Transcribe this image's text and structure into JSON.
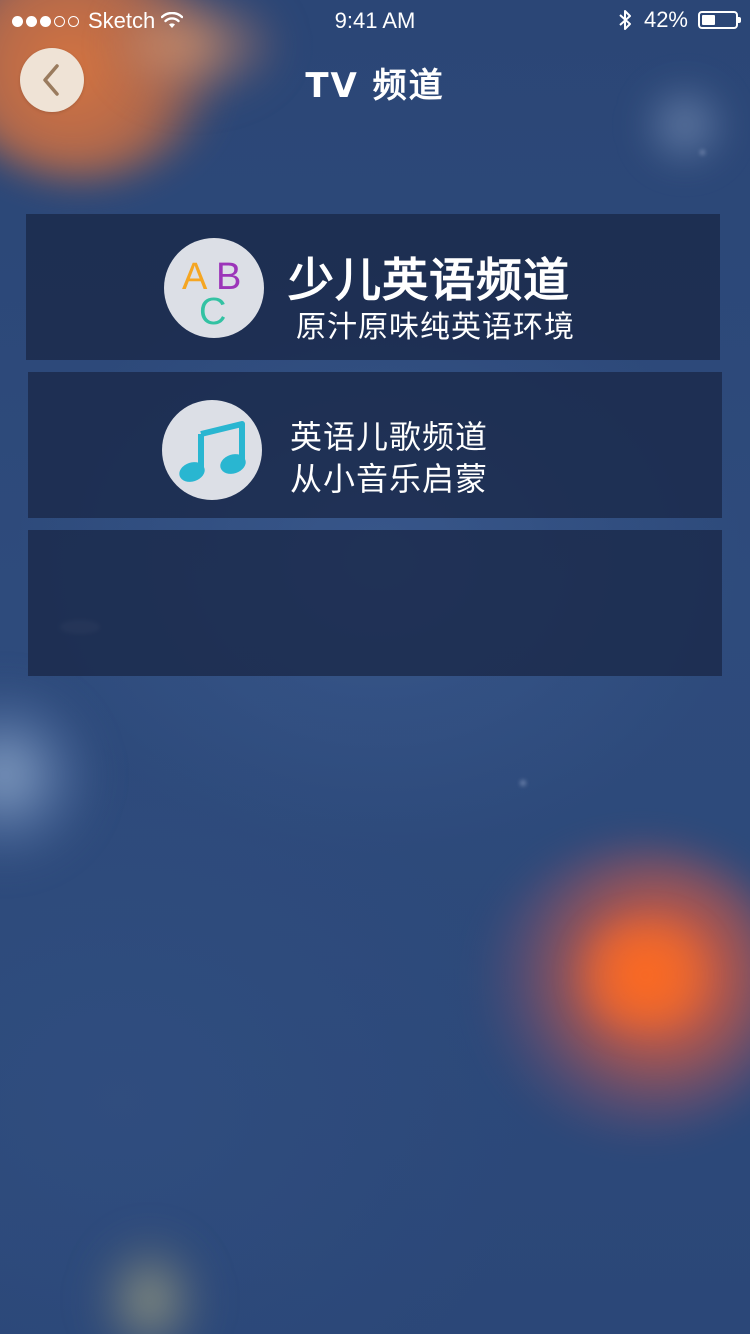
{
  "status_bar": {
    "carrier": "Sketch",
    "signal_bars_full": 3,
    "signal_bars_total": 5,
    "time": "9:41 AM",
    "battery_percent_label": "42%",
    "battery_level": 0.42,
    "icons": [
      "wifi-icon",
      "bluetooth-icon",
      "battery-icon"
    ]
  },
  "nav": {
    "title": "TV 频道",
    "back_icon": "chevron-left-icon"
  },
  "channels": [
    {
      "title": "少儿英语频道",
      "subtitle": "原汁原味纯英语环境",
      "icon": "abc-icon",
      "icon_letters": [
        "A",
        "B",
        "C"
      ],
      "icon_colors": [
        "#f5a623",
        "#9c35b9",
        "#33c2a3"
      ]
    },
    {
      "title": "英语儿歌频道",
      "subtitle": "从小音乐启蒙",
      "icon": "music-note-icon",
      "icon_color": "#29b6d1"
    },
    {
      "title": "",
      "subtitle": ""
    }
  ],
  "colors": {
    "background": "#2b4676",
    "card": "#1a2848",
    "back_button": "#efe3d6",
    "back_chevron": "#9a7b5e",
    "icon_circle": "#dcdfe6"
  }
}
